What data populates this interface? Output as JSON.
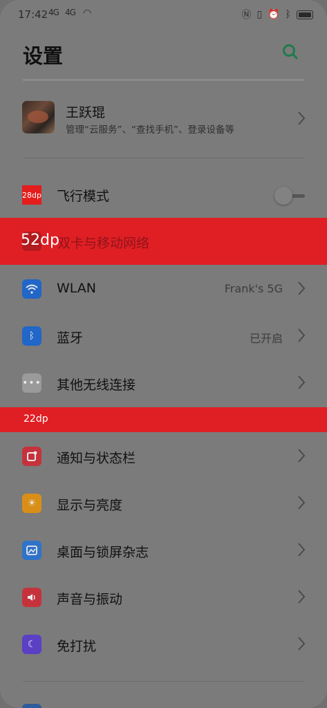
{
  "status": {
    "time": "17:42",
    "signal1": "4G",
    "signal2": "4G"
  },
  "header": {
    "title": "设置"
  },
  "profile": {
    "name": "王跃琨",
    "subtitle": "管理“云服务”、“查找手机”、登录设备等"
  },
  "rows": {
    "airplane": {
      "label": "飞行模式",
      "icon": "airplane-icon"
    },
    "sim": {
      "label": "双卡与移动网络",
      "icon": "sim-card-icon"
    },
    "wlan": {
      "label": "WLAN",
      "value": "Frank's 5G",
      "icon": "wifi-icon",
      "color": "#2166c8"
    },
    "bluetooth": {
      "label": "蓝牙",
      "value": "已开启",
      "icon": "bluetooth-icon",
      "color": "#2166c8"
    },
    "other_wireless": {
      "label": "其他无线连接",
      "icon": "more-dots-icon",
      "color": "#a0a0a0"
    },
    "notification": {
      "label": "通知与状态栏",
      "icon": "notification-icon",
      "color": "#c6323c"
    },
    "display": {
      "label": "显示与亮度",
      "icon": "brightness-icon",
      "color": "#e09a1e"
    },
    "wallpaper": {
      "label": "桌面与锁屏杂志",
      "icon": "wallpaper-icon",
      "color": "#2f73c9"
    },
    "sound": {
      "label": "声音与振动",
      "icon": "speaker-icon",
      "color": "#c6323c"
    },
    "dnd": {
      "label": "免打扰",
      "icon": "moon-icon",
      "color": "#5b3fc4"
    }
  },
  "annotations": {
    "icon_size": "28dp",
    "row_height": "52dp",
    "group_gap": "22dp"
  }
}
